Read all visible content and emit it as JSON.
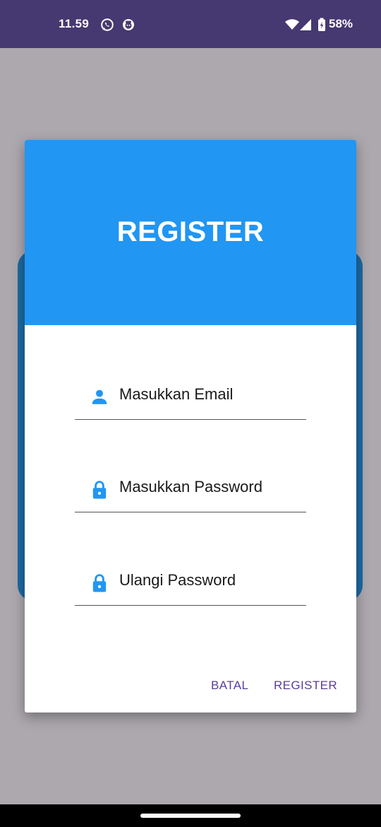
{
  "status_bar": {
    "time": "11.59",
    "battery_percent": "58%",
    "icons": [
      "whatsapp-icon",
      "notification-app-icon",
      "wifi-icon",
      "cell-signal-icon",
      "battery-icon"
    ]
  },
  "dialog": {
    "title": "REGISTER",
    "fields": [
      {
        "icon": "person-icon",
        "placeholder": "Masukkan Email"
      },
      {
        "icon": "lock-icon",
        "placeholder": "Masukkan Password"
      },
      {
        "icon": "lock-icon",
        "placeholder": "Ulangi Password"
      }
    ],
    "buttons": {
      "cancel_label": "BATAL",
      "register_label": "REGISTER"
    }
  },
  "colors": {
    "status_bar": "#463870",
    "header": "#2196f2",
    "icon_accent": "#2196f2",
    "button_text": "#5a3d9a",
    "scrim": "#aca8ae"
  }
}
